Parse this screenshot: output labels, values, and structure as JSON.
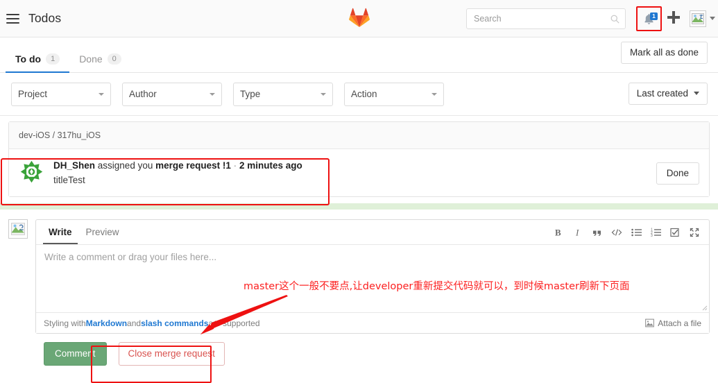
{
  "navbar": {
    "hamburger_icon": "hamburger-menu-icon",
    "title": "Todos",
    "logo_icon": "gitlab-tanuki-logo",
    "search": {
      "placeholder": "Search",
      "value": "",
      "icon": "search-icon"
    },
    "notifications": {
      "icon": "bell-icon",
      "count": "1"
    },
    "new_icon": "plus-icon",
    "avatar_icon": "broken-image-avatar-icon",
    "caret_icon": "chevron-down-icon"
  },
  "tabs": {
    "items": [
      {
        "label": "To do",
        "count": "1",
        "active": true
      },
      {
        "label": "Done",
        "count": "0",
        "active": false
      }
    ],
    "mark_all_label": "Mark all as done"
  },
  "filters": {
    "selects": [
      {
        "label": "Project"
      },
      {
        "label": "Author"
      },
      {
        "label": "Type"
      },
      {
        "label": "Action"
      }
    ],
    "sort": {
      "label": "Last created"
    }
  },
  "todos": {
    "group_header": "dev-iOS / 317hu_iOS",
    "item": {
      "avatar_icon": "identicon-avatar",
      "author": "DH_Shen",
      "action": "assigned you",
      "target": "merge request !1",
      "separator": "·",
      "time": "2 minutes ago",
      "title": "titleTest",
      "done_label": "Done"
    }
  },
  "comment": {
    "avatar_icon": "broken-image-avatar-icon",
    "tabs": [
      {
        "label": "Write",
        "active": true
      },
      {
        "label": "Preview",
        "active": false
      }
    ],
    "toolbar": [
      {
        "icon": "bold-icon",
        "glyph": "B"
      },
      {
        "icon": "italic-icon",
        "glyph": "I"
      },
      {
        "icon": "quote-icon",
        "glyph": "”"
      },
      {
        "icon": "code-icon",
        "glyph": "‹›"
      },
      {
        "icon": "bulleted-list-icon",
        "glyph": "≡"
      },
      {
        "icon": "numbered-list-icon",
        "glyph": "≡"
      },
      {
        "icon": "task-list-icon",
        "glyph": "☑"
      },
      {
        "icon": "fullscreen-icon",
        "glyph": "⤡"
      }
    ],
    "placeholder": "Write a comment or drag your files here...",
    "value": "",
    "footer": {
      "prefix": "Styling with ",
      "markdown_link": "Markdown",
      "middle": " and ",
      "slash_link": "slash commands",
      "suffix": " are supported",
      "attach_label": "Attach a file",
      "attach_icon": "image-file-icon"
    }
  },
  "actions": {
    "comment_label": "Comment",
    "close_mr_label": "Close merge request"
  },
  "annotations": {
    "note_text": "master这个一般不要点,让developer重新提交代码就可以，到时候master刷新下页面",
    "color": "#fc2020",
    "arrow_icon": "red-arrow-icon",
    "highlight_boxes": [
      "notification-bell",
      "todo-item",
      "close-merge-request-button"
    ]
  }
}
